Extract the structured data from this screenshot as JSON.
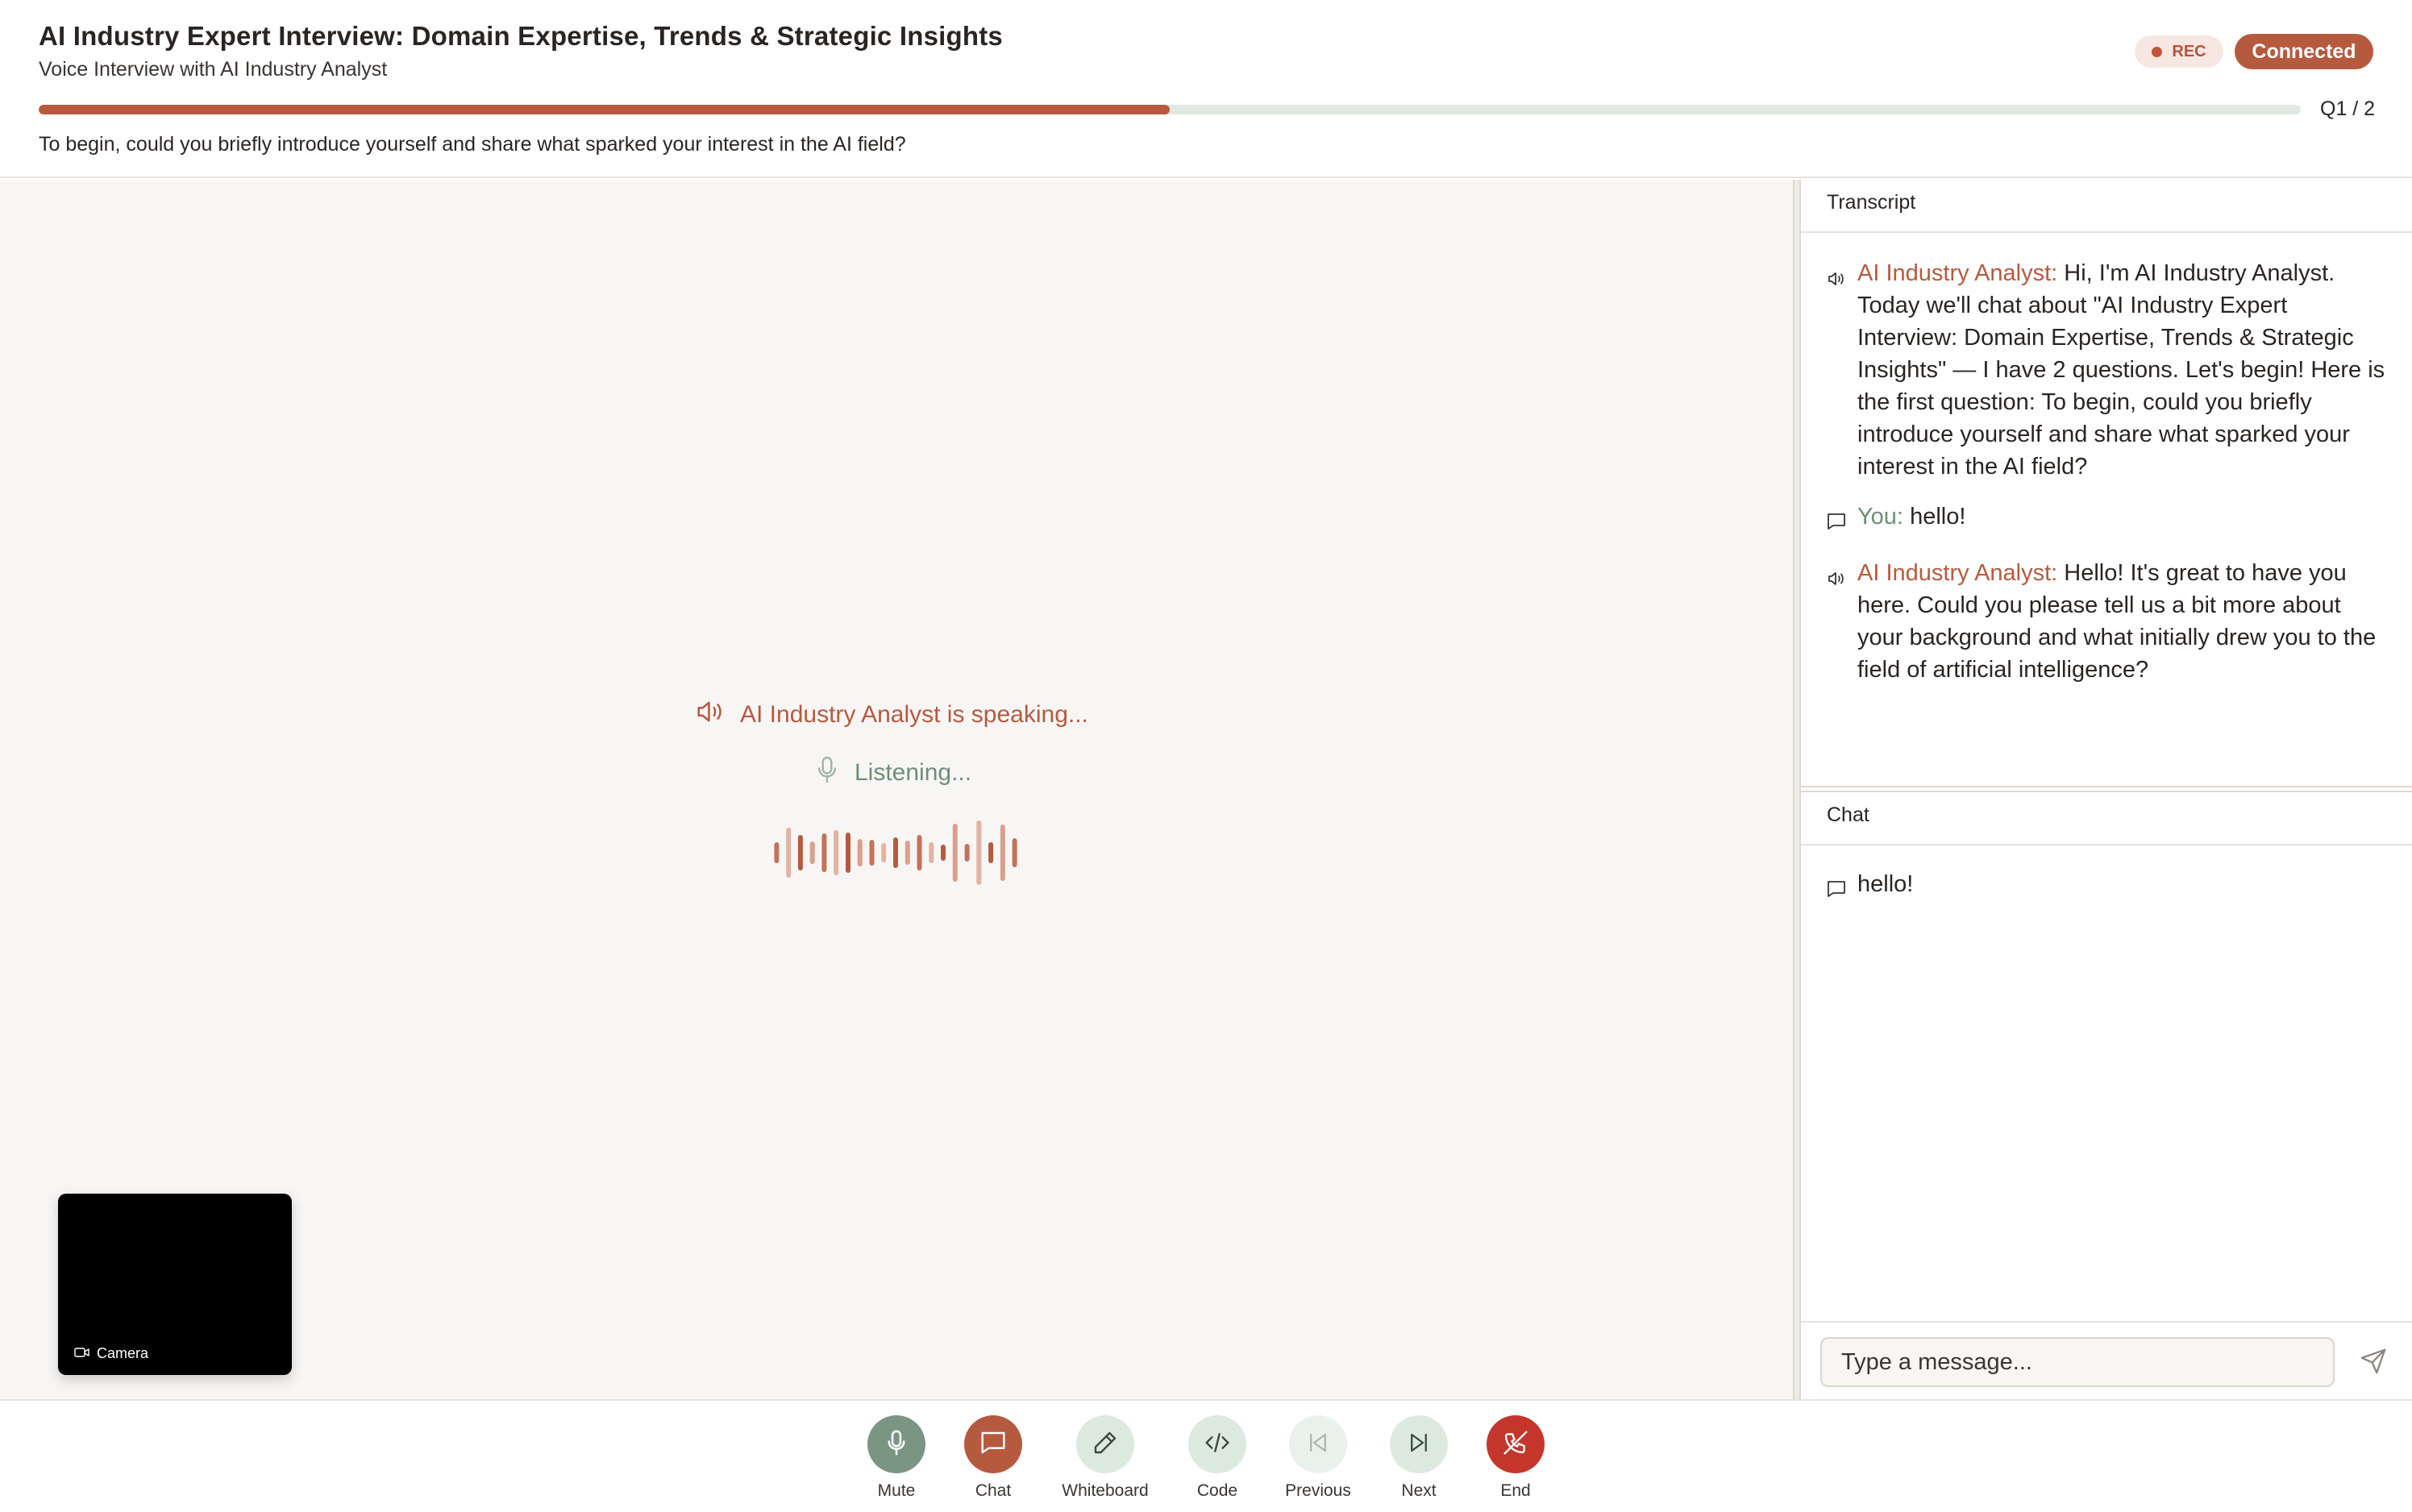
{
  "header": {
    "title": "AI Industry Expert Interview: Domain Expertise, Trends & Strategic Insights",
    "subtitle": "Voice Interview with AI Industry Analyst",
    "rec_label": "REC",
    "status": "Connected",
    "progress_fraction": 0.5,
    "question_counter": "Q1 / 2",
    "current_question": "To begin, could you briefly introduce yourself and share what sparked your interest in the AI field?"
  },
  "stage": {
    "speaking_text": "AI Industry Analyst is speaking...",
    "listening_text": "Listening...",
    "camera_label": "Camera"
  },
  "transcript": {
    "heading": "Transcript",
    "messages": [
      {
        "icon": "speaker-icon",
        "speaker": "AI Industry Analyst:",
        "text": "Hi, I'm AI Industry Analyst. Today we'll chat about \"AI Industry Expert Interview: Domain Expertise, Trends & Strategic Insights\" — I have 2 questions. Let's begin! Here is the first question: To begin, could you briefly introduce yourself and share what sparked your interest in the AI field?"
      },
      {
        "icon": "chat-bubble-icon",
        "speaker": "You:",
        "text": "hello!"
      },
      {
        "icon": "speaker-icon",
        "speaker": "AI Industry Analyst:",
        "text": "Hello! It's great to have you here. Could you please tell us a bit more about your background and what initially drew you to the field of artificial intelligence?"
      }
    ]
  },
  "chat": {
    "heading": "Chat",
    "messages": [
      {
        "icon": "chat-bubble-icon",
        "text": "hello!"
      }
    ],
    "input_placeholder": "Type a message...",
    "input_value": ""
  },
  "toolbar": {
    "buttons": [
      {
        "label": "Mute",
        "icon": "microphone-icon"
      },
      {
        "label": "Chat",
        "icon": "chat-bubble-icon"
      },
      {
        "label": "Whiteboard",
        "icon": "pencil-icon"
      },
      {
        "label": "Code",
        "icon": "code-icon"
      },
      {
        "label": "Previous",
        "icon": "skip-back-icon"
      },
      {
        "label": "Next",
        "icon": "skip-forward-icon"
      },
      {
        "label": "End",
        "icon": "phone-off-icon"
      }
    ]
  },
  "colors": {
    "accent": "#b65a3f",
    "listening": "#6d8f76",
    "end": "#c4362b",
    "muted_button": "#7a9682",
    "soft_button": "#dbe9df"
  }
}
